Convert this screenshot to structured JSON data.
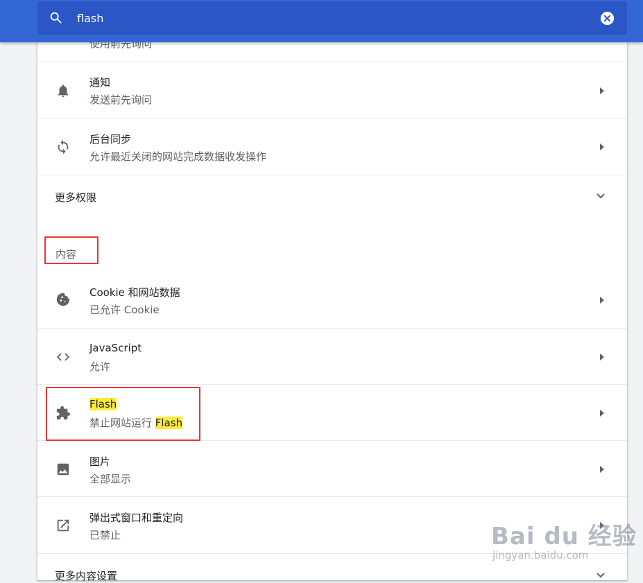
{
  "search": {
    "value": "flash"
  },
  "partial_row": {
    "subtitle": "使用前先询问"
  },
  "rows": [
    {
      "title": "通知",
      "subtitle": "发送前先询问",
      "icon": "bell-icon"
    },
    {
      "title": "后台同步",
      "subtitle": "允许最近关闭的网站完成数据收发操作",
      "icon": "sync-icon"
    }
  ],
  "more_permissions": {
    "label": "更多权限"
  },
  "content_section": {
    "title": "内容",
    "rows": [
      {
        "title": "Cookie 和网站数据",
        "subtitle": "已允许 Cookie",
        "icon": "cookie-icon"
      },
      {
        "title": "JavaScript",
        "subtitle": "允许",
        "icon": "code-icon"
      },
      {
        "title": "Flash",
        "subtitle_prefix": "禁止网站运行 ",
        "subtitle_highlight": "Flash",
        "icon": "puzzle-icon"
      },
      {
        "title": "图片",
        "subtitle": "全部显示",
        "icon": "image-icon"
      },
      {
        "title": "弹出式窗口和重定向",
        "subtitle": "已禁止",
        "icon": "open-in-new-icon"
      }
    ]
  },
  "more_content_settings": {
    "label": "更多内容设置"
  },
  "watermark": {
    "brand": "Bai du 经验",
    "url": "jingyan.baidu.com"
  },
  "colors": {
    "header": "#3367d6",
    "search_bg": "#2a56c6",
    "highlight": "#ffeb3b",
    "annotation": "#e53935"
  }
}
